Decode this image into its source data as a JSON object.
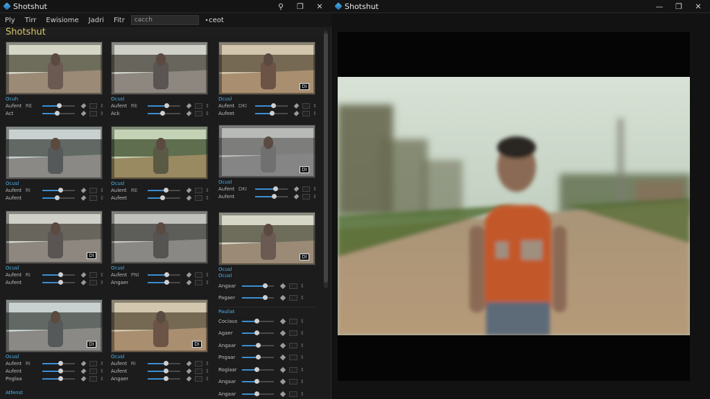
{
  "left_window": {
    "title": "Shotshut",
    "controls": {
      "pin": "⚲",
      "restore": "❐",
      "close": "✕"
    }
  },
  "menu": {
    "items": [
      "Ply",
      "Tirr",
      "Ewisiome",
      "Jadri",
      "Fitr"
    ],
    "search_value": "cacch",
    "extra": "⋆ceot"
  },
  "panel_header": "Shotshut",
  "thumbnails": [
    {
      "name": "Ocuh",
      "rows": [
        {
          "label": "Aufent",
          "mini": "RE",
          "value": 0.52
        },
        {
          "label": "Act",
          "mini": "",
          "value": 0.45
        }
      ],
      "tone": "warm",
      "badge": ""
    },
    {
      "name": "Ocusl",
      "rows": [
        {
          "label": "Aufent",
          "mini": "RE",
          "value": 0.58
        },
        {
          "label": "Ack",
          "mini": "",
          "value": 0.45
        }
      ],
      "tone": "neutral",
      "badge": ""
    },
    {
      "name": "Dcusl",
      "rows": [
        {
          "label": "Aufent",
          "mini": "DKI",
          "value": 0.55
        },
        {
          "label": "Aufeet",
          "mini": "",
          "value": 0.52
        }
      ],
      "tone": "sepia",
      "badge": "DI"
    },
    {
      "name": "Ocusl",
      "rows": [
        {
          "label": "Aufent",
          "mini": "RI",
          "value": 0.55
        },
        {
          "label": "Aufent",
          "mini": "",
          "value": 0.45
        }
      ],
      "tone": "cool",
      "badge": ""
    },
    {
      "name": "Ocusl",
      "rows": [
        {
          "label": "Aulent",
          "mini": "RE",
          "value": 0.55
        },
        {
          "label": "Aufeet",
          "mini": "",
          "value": 0.45
        }
      ],
      "tone": "green",
      "badge": ""
    },
    {
      "name": "Ocusl",
      "rows": [
        {
          "label": "Aufent",
          "mini": "DKI",
          "value": 0.62
        },
        {
          "label": "Aufent",
          "mini": "",
          "value": 0.58
        }
      ],
      "tone": "haze",
      "badge": "DI"
    },
    {
      "name": "Ocusl",
      "rows": [
        {
          "label": "Aufent",
          "mini": "RI",
          "value": 0.55
        },
        {
          "label": "Aufent",
          "mini": "",
          "value": 0.55
        }
      ],
      "tone": "neutral",
      "badge": "DI"
    },
    {
      "name": "Ocusl",
      "rows": [
        {
          "label": "Aufent",
          "mini": "PNI",
          "value": 0.58
        },
        {
          "label": "Angaer",
          "mini": "",
          "value": 0.58
        }
      ],
      "tone": "mono",
      "badge": ""
    },
    {
      "name": "Ocusl",
      "rows": [],
      "tone": "warm",
      "badge": "DI"
    },
    {
      "name": "Ocusl",
      "rows": [
        {
          "label": "Aufent",
          "mini": "RI",
          "value": 0.55
        },
        {
          "label": "Aufent",
          "mini": "",
          "value": 0.55
        },
        {
          "label": "Pnglaa",
          "mini": "",
          "value": 0.55
        }
      ],
      "tone": "cool",
      "badge": "DI"
    },
    {
      "name": "Ocusl",
      "rows": [
        {
          "label": "Aufent",
          "mini": "RI",
          "value": 0.55
        },
        {
          "label": "Aufent",
          "mini": "",
          "value": 0.55
        },
        {
          "label": "Angaer",
          "mini": "",
          "value": 0.55
        }
      ],
      "tone": "sepia",
      "badge": "DI"
    }
  ],
  "adjust_panel": {
    "title": "Ocusl",
    "rows_top": [
      {
        "label": "Angaar",
        "value": 0.72
      },
      {
        "label": "Pagaer",
        "value": 0.72
      }
    ],
    "section": "Pauliat",
    "rows_bottom": [
      {
        "label": "Cociaus",
        "value": 0.45
      },
      {
        "label": "Agaer",
        "value": 0.45
      },
      {
        "label": "Angaar",
        "value": 0.5
      },
      {
        "label": "Pngaar",
        "value": 0.5
      },
      {
        "label": "Rogiaar",
        "value": 0.45
      },
      {
        "label": "Angaar",
        "value": 0.45
      },
      {
        "label": "Angaar",
        "value": 0.45
      }
    ]
  },
  "footer_link": "Atfenst",
  "right_window": {
    "title": "Shotshut",
    "controls": {
      "minimize": "—",
      "restore": "❐",
      "close": "✕"
    }
  },
  "colors": {
    "accent": "#4fb0e8",
    "header": "#d9c968",
    "bg": "#1c1c1c"
  }
}
